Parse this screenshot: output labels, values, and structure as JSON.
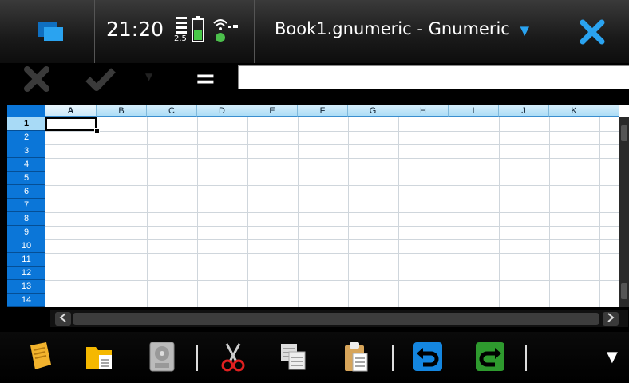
{
  "statusbar": {
    "clock": "21:20",
    "battery_label": "2.5",
    "window_title": "Book1.gnumeric - Gnumeric",
    "menu_arrow": "▼"
  },
  "editbar": {
    "equals_symbol": "=",
    "formula_value": "",
    "dropdown_arrow": "▼"
  },
  "sheet": {
    "columns": [
      "A",
      "B",
      "C",
      "D",
      "E",
      "F",
      "G",
      "H",
      "I",
      "J",
      "K"
    ],
    "rows": [
      "1",
      "2",
      "3",
      "4",
      "5",
      "6",
      "7",
      "8",
      "9",
      "10",
      "11",
      "12",
      "13",
      "14"
    ],
    "selected_cell": "A1",
    "header_color": "#0b76d8"
  },
  "toolbar": {
    "more_arrow": "▼",
    "icons": [
      "new-document-icon",
      "open-folder-icon",
      "save-disk-icon",
      "cut-scissors-icon",
      "copy-icon",
      "paste-icon",
      "undo-icon",
      "redo-icon"
    ]
  }
}
